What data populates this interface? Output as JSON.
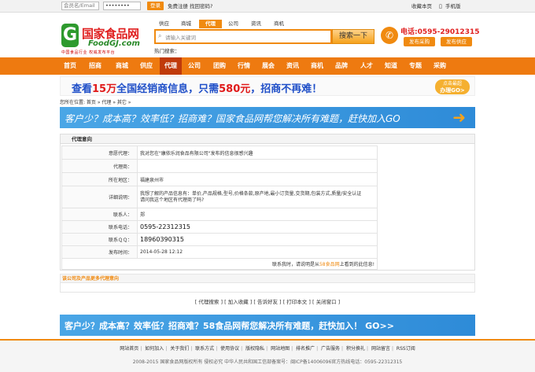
{
  "topbar": {
    "account_placeholder": "会员名/Email",
    "password_value": "••••••••",
    "login_label": "登录",
    "register_label": "免费注册",
    "forgot_label": "找回密码?",
    "favorite_label": "收藏本页",
    "mobile_label": "手机版"
  },
  "logo": {
    "letter": "G",
    "cn": "国家食品网",
    "en": "FoodGJ.com",
    "slogan": "中国食品行业 权威发布平台"
  },
  "search": {
    "tabs": [
      "供应",
      "商城",
      "代理",
      "公司",
      "资讯",
      "商机"
    ],
    "active_tab": "代理",
    "placeholder": "请输入关键词",
    "button_label": "搜索一下",
    "hot_label": "热门搜索："
  },
  "contact": {
    "phone": "电话:0595-29012315",
    "publish_buy": "发布采购",
    "publish_supply": "发布供应"
  },
  "nav": {
    "items": [
      "首页",
      "招商",
      "商城",
      "供应",
      "代理",
      "公司",
      "团购",
      "行情",
      "展会",
      "资讯",
      "商机",
      "品牌",
      "人才",
      "知道",
      "专题",
      "采购"
    ],
    "active": "代理"
  },
  "banner1": {
    "part1": "查看",
    "num1": "15万",
    "part2": "全国经销商信息，只需",
    "num2": "580元",
    "part3": "，招商不再难！",
    "badge_top": "点击最超",
    "badge_bottom": "办理GO>"
  },
  "breadcrumb": "您所在位置: 首页 » 代理 » 其它 »",
  "banner2": {
    "text": "客户少？成本高？效率低？招商难？国家食品网帮您解决所有难题，赶快加入GO",
    "arrow": "➜"
  },
  "panel": {
    "title": "代理意向",
    "rows": [
      {
        "label": "意愿代理：",
        "value": "我对您在\"康依乐润食品有限公司\"发布的信息很感兴趣"
      },
      {
        "label": "代理商：",
        "value": ""
      },
      {
        "label": "所在地区：",
        "value": "福建泉州市"
      },
      {
        "label": "详细说明：",
        "value": "我想了解的产品信息有：单价,产品规格,型号,价格条款,原产地,最小订货量,交货期,包装方式,质量/安全认证\n请问我这个地区有代理商了吗?"
      },
      {
        "label": "联系人：",
        "value": "郑"
      },
      {
        "label": "联系电话：",
        "value": "0595-22312315"
      },
      {
        "label": "联系ＱＱ：",
        "value": "18960390315"
      },
      {
        "label": "发布时间：",
        "value": "2014-05-28 12:12"
      }
    ],
    "footer_before": "联系我时，请说明是从",
    "footer_highlight": "58食品网",
    "footer_after": "上看到的此信息!"
  },
  "more_bar": "该公司及产品更多代理意向",
  "actions": [
    "[ 代理搜索 ]",
    "[ 加入收藏 ]",
    "[ 告诉好友 ]",
    "[ 打印本文 ]",
    "[ 关闭窗口 ]"
  ],
  "banner3": {
    "text": "客户少？成本高？效率低？招商难？58食品网帮您解决所有难题，赶快加入！ GO>>"
  },
  "footer": {
    "links": [
      "网站首页",
      "如何加入",
      "关于我们",
      "联系方式",
      "使用协议",
      "版权隐私",
      "网站地图",
      "排名推广",
      "广告服务",
      "积分换礼",
      "网站留言",
      "RSS订阅"
    ],
    "copyright": "2008-2015 国家食品网版权所有 侵权必究 中华人民共和国工信部备案号：闽ICP备14006096官方热线电话：0595-22312315"
  },
  "colors": {
    "accent": "#f08a10",
    "nav_bg": "#ee7a10",
    "logo_red": "#e02020",
    "logo_green": "#2e9a2e",
    "banner_blue": "#2e8bd8"
  }
}
